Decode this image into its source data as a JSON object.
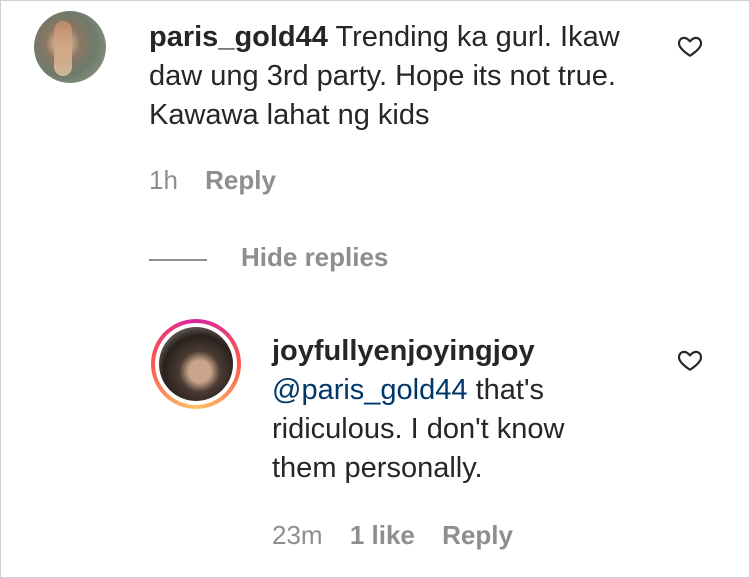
{
  "comments": [
    {
      "username": "paris_gold44",
      "text": "Trending ka gurl. Ikaw daw ung 3rd party. Hope its not true. Kawawa lahat ng kids",
      "time": "1h",
      "reply_label": "Reply"
    }
  ],
  "hide_replies_label": "Hide replies",
  "reply": {
    "username": "joyfullyenjoyingjoy",
    "mention": "@paris_gold44",
    "text": "that's ridiculous. I don't know them personally.",
    "time": "23m",
    "likes": "1 like",
    "reply_label": "Reply"
  },
  "icons": [
    "heart-outline-icon"
  ],
  "colors": {
    "mention": "#00376b",
    "meta": "#8e8e8e",
    "text": "#262626"
  }
}
